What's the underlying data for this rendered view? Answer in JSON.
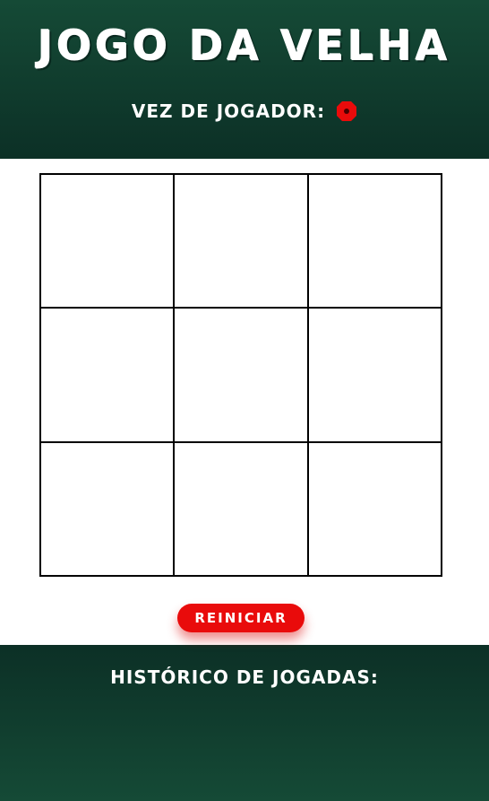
{
  "header": {
    "title": "Jogo da Velha",
    "turn_label": "Vez de jogador:",
    "current_player_icon": "red-octagon-icon",
    "current_player_color": "#e90b0b"
  },
  "board": {
    "cells": [
      "",
      "",
      "",
      "",
      "",
      "",
      "",
      "",
      ""
    ]
  },
  "controls": {
    "restart_label": "Reiniciar",
    "accent_color": "#e90b0b"
  },
  "history": {
    "title": "Histórico de jogadas:",
    "moves": []
  },
  "colors": {
    "header_bg": "#154a36",
    "header_bg_dark": "#0c3026",
    "grid_line": "#000000"
  }
}
